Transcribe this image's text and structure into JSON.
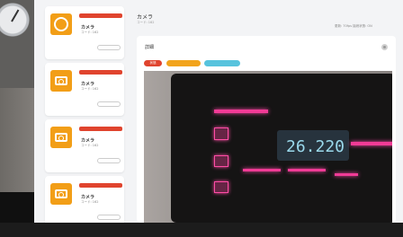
{
  "sidebar": {
    "cards": [
      {
        "title": "カメラ",
        "subtitle": "コード: 162",
        "footer": "",
        "button": ""
      },
      {
        "title": "カメラ",
        "subtitle": "コード: 162",
        "footer": "",
        "button": ""
      },
      {
        "title": "カメラ",
        "subtitle": "コード: 162",
        "footer": "",
        "button": ""
      },
      {
        "title": "カメラ",
        "subtitle": "コード: 162",
        "footer": "",
        "button": ""
      }
    ]
  },
  "header": {
    "title": "カメラ",
    "subtitle": "コード: 162",
    "meta": "更新: 70fps 接続状態: ON"
  },
  "detail": {
    "title": "詳細",
    "tags": [
      "状態",
      "",
      ""
    ],
    "reading": "26.220"
  },
  "status": {
    "left": "",
    "right": ""
  },
  "colors": {
    "accent": "#e0442e",
    "orange": "#f29e17",
    "blue": "#57c3dd",
    "display": "#9ad9ec",
    "pink": "#f13b96"
  }
}
